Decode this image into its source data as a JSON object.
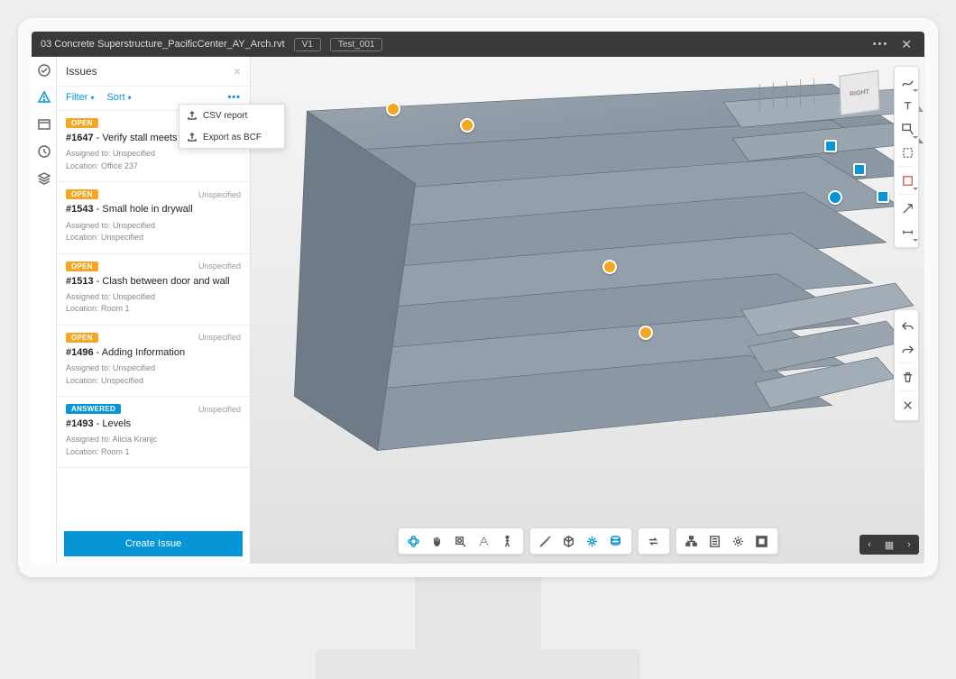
{
  "titlebar": {
    "filename": "03 Concrete Superstructure_PacificCenter_AY_Arch.rvt",
    "version": "V1",
    "test": "Test_001"
  },
  "panel": {
    "title": "Issues",
    "filter_label": "Filter",
    "sort_label": "Sort",
    "create_button": "Create Issue"
  },
  "popover": {
    "csv": "CSV report",
    "bcf": "Export as BCF"
  },
  "issues": [
    {
      "status": "OPEN",
      "status_class": "open",
      "id": "#1647",
      "title": "Verify stall meets ADA",
      "assigned": "Assigned to: Unspecified",
      "location": "Location: Office 237",
      "due": ""
    },
    {
      "status": "OPEN",
      "status_class": "open",
      "id": "#1543",
      "title": "Small hole in drywall",
      "assigned": "Assigned to: Unspecified",
      "location": "Location: Unspecified",
      "due": "Unspecified"
    },
    {
      "status": "OPEN",
      "status_class": "open",
      "id": "#1513",
      "title": "Clash between door and wall",
      "assigned": "Assigned to: Unspecified",
      "location": "Location: Room 1",
      "due": "Unspecified"
    },
    {
      "status": "OPEN",
      "status_class": "open",
      "id": "#1496",
      "title": "Adding Information",
      "assigned": "Assigned to: Unspecified",
      "location": "Location: Unspecified",
      "due": "Unspecified"
    },
    {
      "status": "ANSWERED",
      "status_class": "answered",
      "id": "#1493",
      "title": "Levels",
      "assigned": "Assigned to: Alicia Kranjc",
      "location": "Location: Room 1",
      "due": "Unspecified"
    }
  ],
  "viewcube": {
    "face": "RIGHT"
  }
}
